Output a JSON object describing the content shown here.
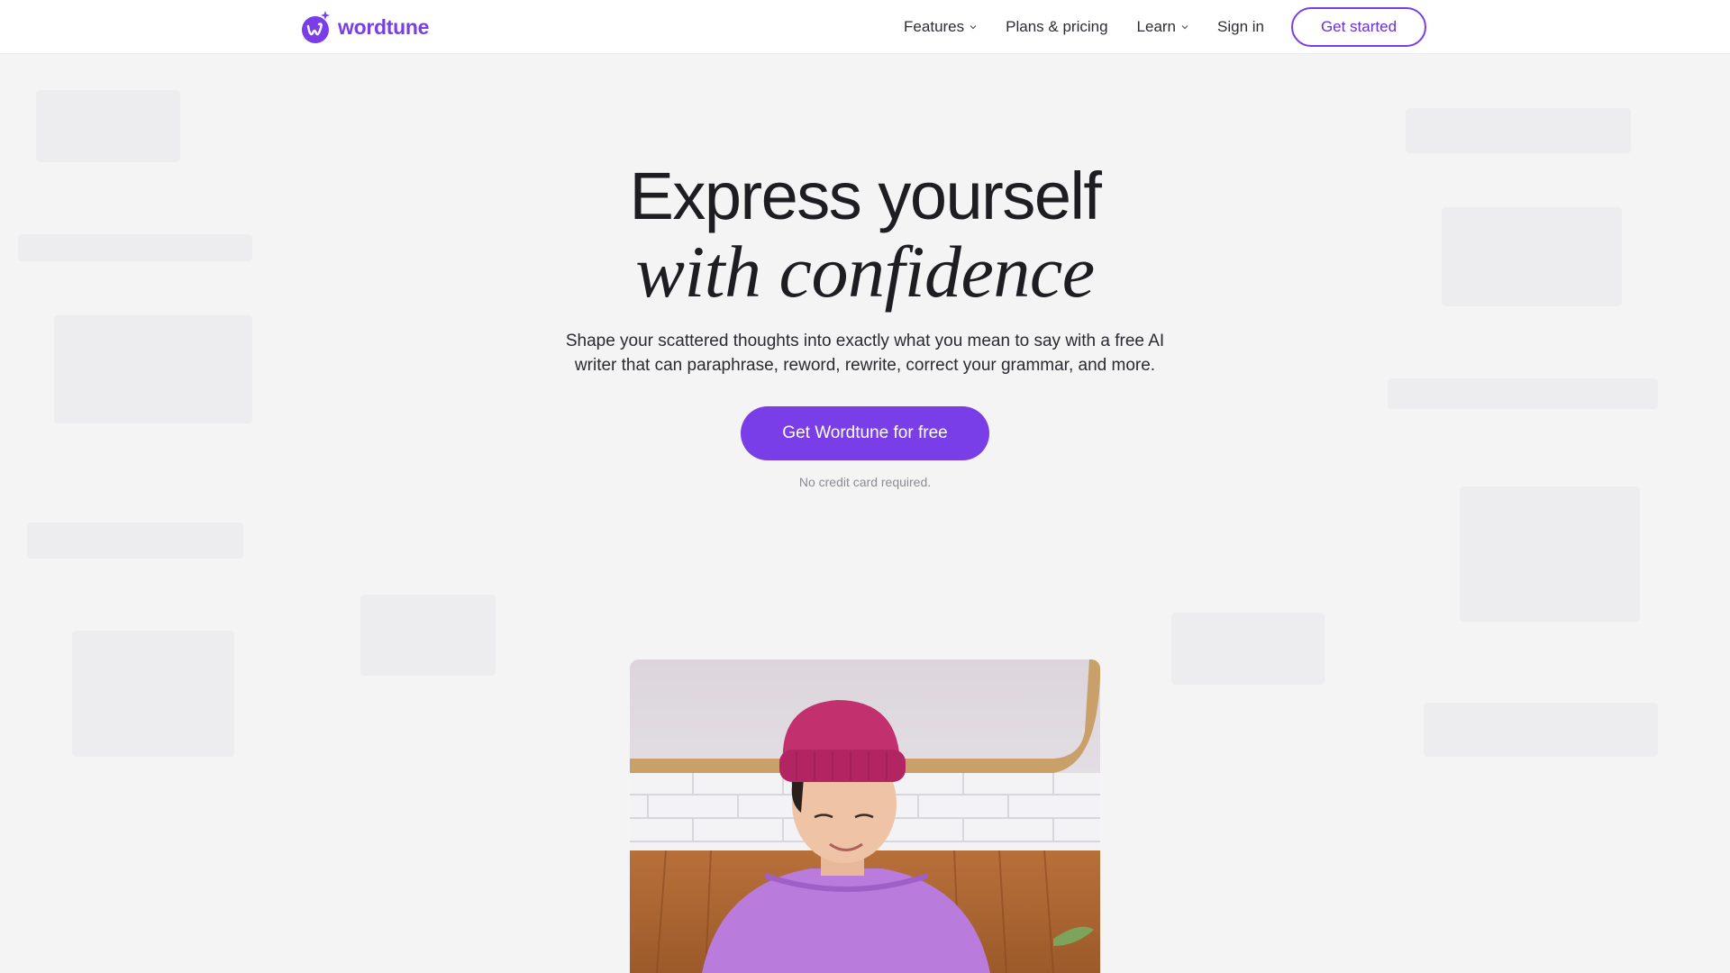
{
  "brand": {
    "name": "wordtune",
    "accent": "#7a3ee8"
  },
  "nav": {
    "items": [
      {
        "label": "Features",
        "has_dropdown": true
      },
      {
        "label": "Plans & pricing",
        "has_dropdown": false
      },
      {
        "label": "Learn",
        "has_dropdown": true
      },
      {
        "label": "Sign in",
        "has_dropdown": false
      }
    ],
    "cta_label": "Get started"
  },
  "hero": {
    "title_line1": "Express yourself",
    "title_line2": "with confidence",
    "subtitle": "Shape your scattered thoughts into exactly what you mean to say with a free AI writer that can paraphrase, reword, rewrite, correct your grammar, and more.",
    "cta_label": "Get Wordtune for free",
    "note": "No credit card required."
  },
  "icons": {
    "logo": "wordtune-logo-icon",
    "dropdown": "chevron-down-icon"
  }
}
